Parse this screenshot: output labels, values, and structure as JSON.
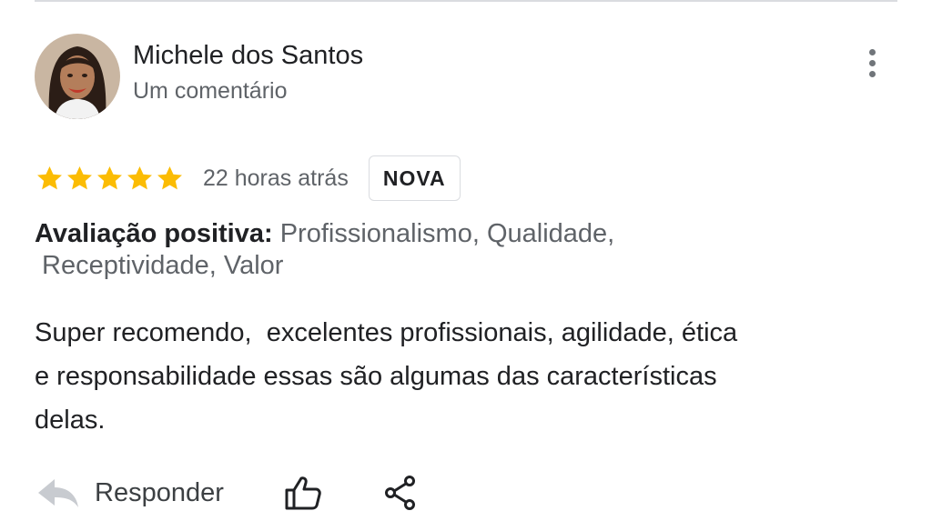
{
  "review": {
    "reviewer_name": "Michele dos Santos",
    "reviewer_subtitle": "Um comentário",
    "rating": 5,
    "rating_max": 5,
    "time_ago": "22 horas atrás",
    "badge": "NOVA",
    "positive_label": "Avaliação positiva:",
    "positive_values_line1": "Profissionalismo, Qualidade,",
    "positive_values_line2": "Receptividade, Valor",
    "comment_line1": "Super recomendo,  excelentes profissionais, agilidade, ética",
    "comment_line2": "e responsabilidade essas são algumas das características",
    "comment_line3": "delas."
  },
  "actions": {
    "reply_label": "Responder"
  },
  "icons": {
    "avatar": "reviewer-avatar",
    "more": "more-vert-icon",
    "star": "star-icon",
    "reply": "reply-arrow-icon",
    "like": "thumb-up-icon",
    "share": "share-icon"
  },
  "colors": {
    "star": "#fbbc04",
    "text_primary": "#202124",
    "text_secondary": "#5f6368",
    "divider": "#dadce0"
  }
}
